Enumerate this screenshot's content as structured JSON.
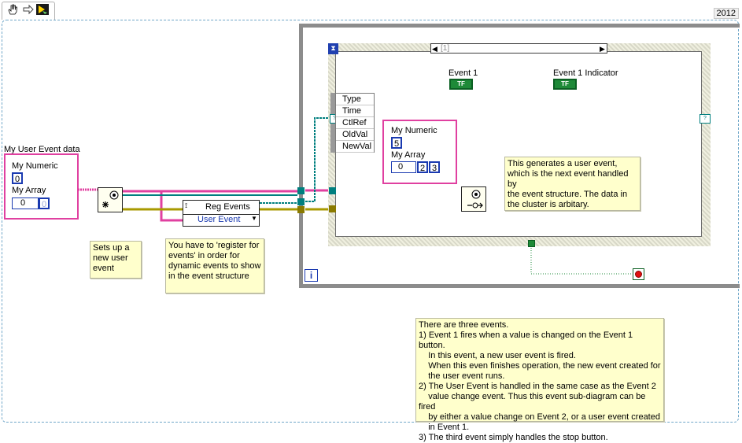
{
  "toolbar": {
    "version": "2012",
    "icons": [
      "hand-icon",
      "run-arrow-icon",
      "highlight-execution-icon"
    ]
  },
  "outside": {
    "cluster_label": "My User Event data",
    "numeric_label": "My Numeric",
    "numeric_value": "0",
    "array_label": "My Array",
    "array_index": "0",
    "array_value": "0"
  },
  "reg_events": {
    "title": "Reg Events",
    "dropdown": "User Event"
  },
  "notes": {
    "create_event": "Sets up a\nnew user\nevent",
    "register": "You have to 'register for\nevents' in order for\ndynamic events to show\nin the event structure",
    "generates": "This generates a user event,\nwhich is the next event handled by\nthe event structure. The data in\nthe cluster is arbitary.",
    "explanation": "There are three events.\n1) Event 1 fires when a value is changed on the Event 1 button.\n    In this event, a new user event is fired.\n    When this even finishes operation, the new event created for\n    the user event runs.\n2) The User Event is handled in the same case as the Event 2\n    value change event. Thus this event sub-diagram can be fired\n    by either a value change on Event 2, or a user event created\n    in Event 1.\n3) The third event simply handles the stop button."
  },
  "event_structure": {
    "case_label": "[1]",
    "event_data_fields": [
      "Type",
      "Time",
      "CtlRef",
      "OldVal",
      "NewVal"
    ],
    "event1_label": "Event 1",
    "event1_indicator_label": "Event 1 Indicator",
    "tf_text": "TF",
    "inner_cluster": {
      "numeric_label": "My Numeric",
      "numeric_value": "5",
      "array_label": "My Array",
      "array_index": "0",
      "array_values": [
        "2",
        "3"
      ]
    }
  },
  "loop": {
    "iteration_label": "i"
  },
  "colors": {
    "cluster_wire": "#e040a0",
    "refnum_wire": "#007f7f",
    "error_wire": "#8a7a00",
    "boolean": "#1e8a38",
    "numeric": "#1a3ab0",
    "note_bg": "#ffffcc"
  }
}
